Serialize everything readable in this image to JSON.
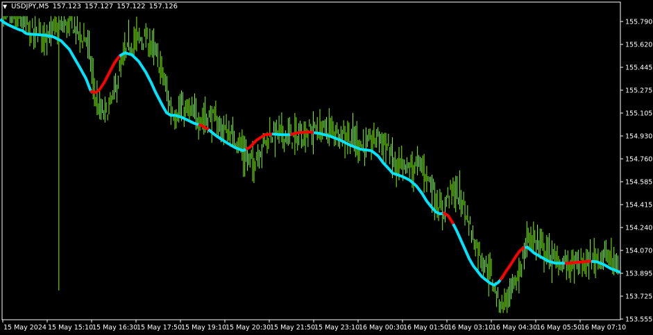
{
  "header": {
    "symbol": "USDJPY,M5",
    "bid": "157.123",
    "high": "157.127",
    "low": "157.122",
    "close": "157.126"
  },
  "colors": {
    "background": "#000000",
    "frame": "#ffffff",
    "candles": "#7CFC00",
    "ma_up": "#00E5FF",
    "ma_down": "#FF0000"
  },
  "chart_data": {
    "type": "line",
    "ylim": [
      153.555,
      155.95
    ],
    "y_ticks": [
      "155.790",
      "155.620",
      "155.445",
      "155.275",
      "155.105",
      "154.930",
      "154.760",
      "154.585",
      "154.415",
      "154.240",
      "154.070",
      "153.895",
      "153.725",
      "153.555"
    ],
    "x_ticks": [
      "15 May 2024",
      "15 May 15:10",
      "15 May 16:30",
      "15 May 17:50",
      "15 May 19:10",
      "15 May 20:30",
      "15 May 21:50",
      "15 May 23:10",
      "16 May 00:30",
      "16 May 01:50",
      "16 May 03:10",
      "16 May 04:30",
      "16 May 05:50",
      "16 May 07:10"
    ],
    "ma_anchor_x": [
      0,
      5,
      12,
      19,
      27,
      33,
      37,
      43,
      50,
      58,
      67,
      77,
      88,
      100,
      115,
      124,
      131,
      137,
      143,
      150,
      158,
      165,
      172,
      180,
      190,
      200,
      210,
      218,
      224,
      230,
      235,
      240,
      246,
      253,
      262,
      270,
      280,
      290,
      300,
      312,
      325,
      338,
      350,
      360,
      370,
      382,
      393,
      405,
      418,
      430,
      445,
      460,
      475,
      490,
      505,
      520,
      535,
      545,
      552,
      560,
      566,
      572,
      580,
      590,
      600,
      608,
      615,
      622,
      628,
      634,
      640,
      646,
      652,
      658,
      664,
      670,
      676,
      682,
      688,
      694,
      700,
      706,
      712,
      718,
      724,
      730,
      736,
      742,
      748,
      754,
      760,
      770,
      780,
      790,
      800,
      810,
      820,
      830,
      840,
      850,
      860,
      870,
      880,
      892
    ],
    "ma_anchor_price": [
      155.81,
      155.785,
      155.765,
      155.748,
      155.73,
      155.72,
      155.7,
      155.695,
      155.693,
      155.69,
      155.685,
      155.675,
      155.645,
      155.58,
      155.445,
      155.36,
      155.265,
      155.255,
      155.275,
      155.33,
      155.41,
      155.48,
      155.53,
      155.555,
      155.54,
      155.49,
      155.41,
      155.33,
      155.26,
      155.2,
      155.15,
      155.105,
      155.085,
      155.085,
      155.07,
      155.05,
      155.025,
      155.01,
      154.98,
      154.93,
      154.885,
      154.845,
      154.82,
      154.845,
      154.9,
      154.94,
      154.945,
      154.94,
      154.94,
      154.955,
      154.96,
      154.95,
      154.93,
      154.9,
      154.86,
      154.83,
      154.82,
      154.78,
      154.73,
      154.685,
      154.65,
      154.64,
      154.625,
      154.6,
      154.555,
      154.5,
      154.44,
      154.395,
      154.36,
      154.345,
      154.35,
      154.33,
      154.28,
      154.22,
      154.15,
      154.08,
      154.01,
      153.955,
      153.915,
      153.875,
      153.85,
      153.825,
      153.81,
      153.83,
      153.87,
      153.92,
      153.965,
      154.015,
      154.06,
      154.09,
      154.095,
      154.05,
      154.02,
      153.99,
      153.975,
      153.975,
      153.975,
      153.98,
      153.985,
      153.99,
      153.985,
      153.965,
      153.935,
      153.91
    ],
    "ma_down_segments": [
      [
        131,
        176
      ],
      [
        287,
        303
      ],
      [
        355,
        395
      ],
      [
        420,
        455
      ],
      [
        640,
        655
      ],
      [
        722,
        760
      ],
      [
        815,
        855
      ]
    ]
  }
}
